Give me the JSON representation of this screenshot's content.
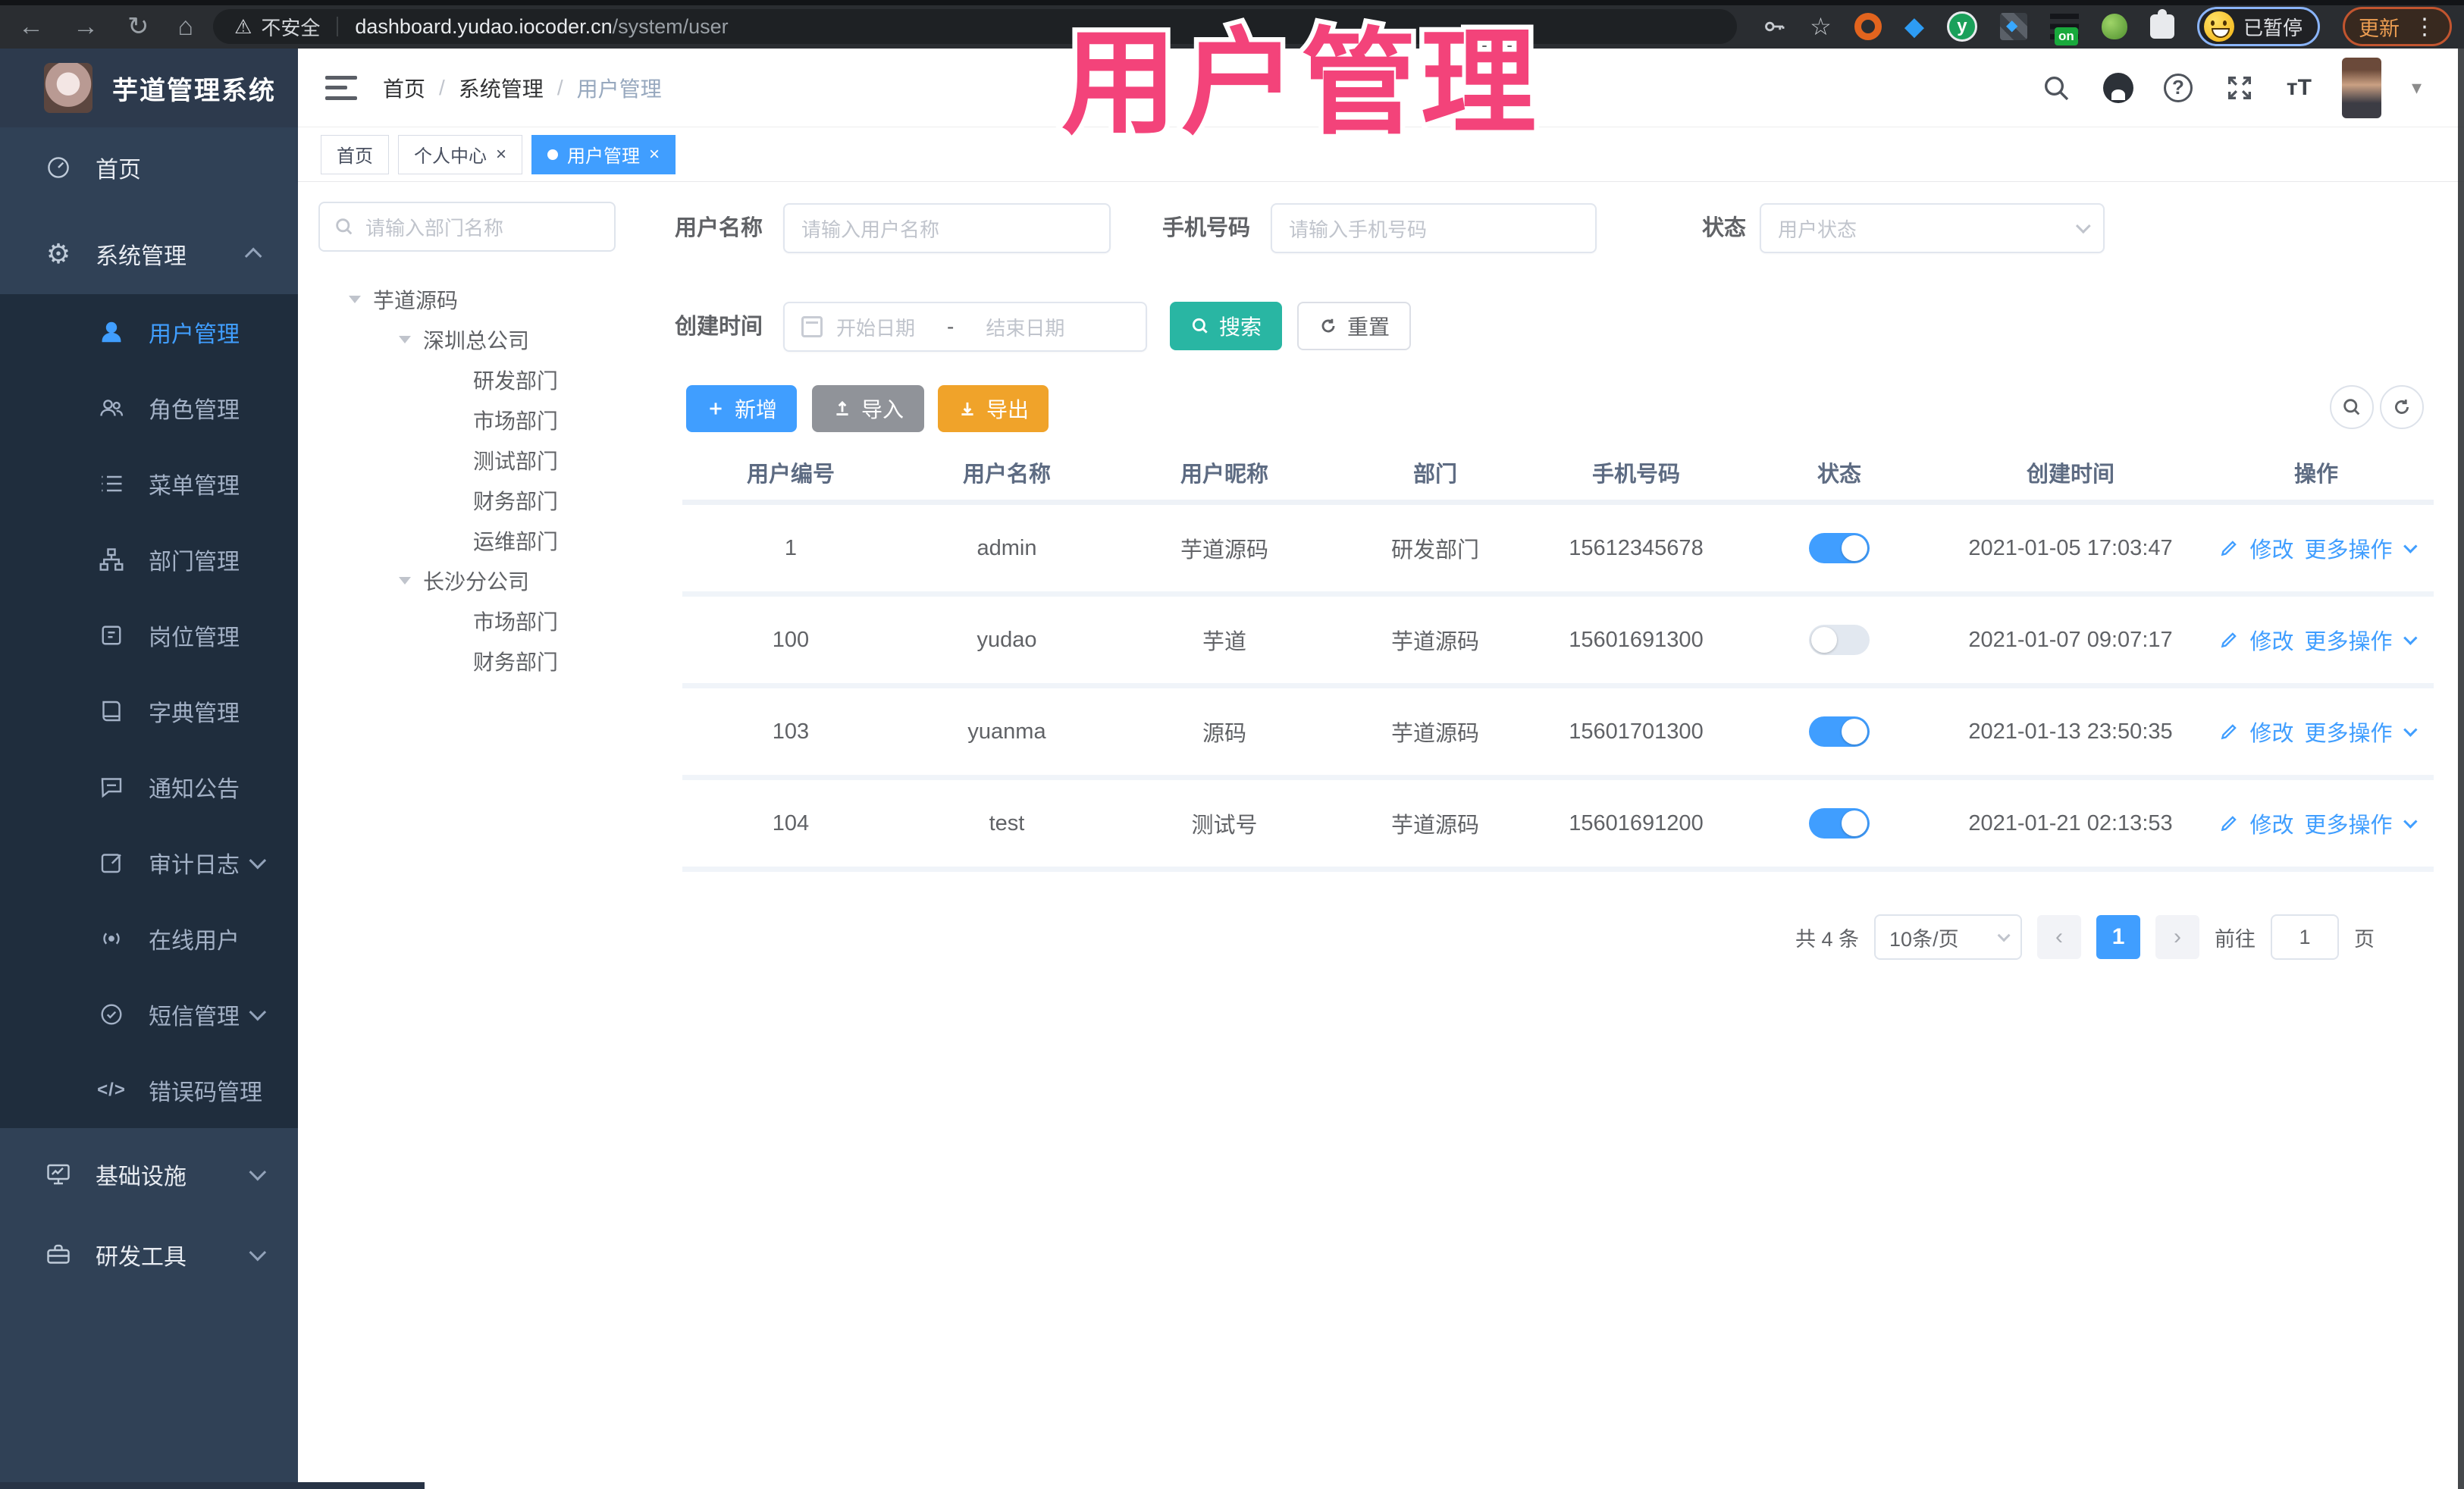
{
  "browser": {
    "security_label": "不安全",
    "url_domain": "dashboard.yudao.iocoder.cn",
    "url_path": "/system/user",
    "ext_badge": "on",
    "profile_status": "已暂停",
    "update_label": "更新"
  },
  "sidebar": {
    "app_title": "芋道管理系统",
    "top_items": [
      {
        "label": "首页"
      },
      {
        "label": "系统管理"
      }
    ],
    "sub_items": [
      {
        "label": "用户管理"
      },
      {
        "label": "角色管理"
      },
      {
        "label": "菜单管理"
      },
      {
        "label": "部门管理"
      },
      {
        "label": "岗位管理"
      },
      {
        "label": "字典管理"
      },
      {
        "label": "通知公告"
      },
      {
        "label": "审计日志"
      },
      {
        "label": "在线用户"
      },
      {
        "label": "短信管理"
      },
      {
        "label": "错误码管理"
      }
    ],
    "bottom_items": [
      {
        "label": "基础设施"
      },
      {
        "label": "研发工具"
      }
    ]
  },
  "header": {
    "breadcrumb": [
      "首页",
      "系统管理",
      "用户管理"
    ]
  },
  "tabs": [
    {
      "label": "首页"
    },
    {
      "label": "个人中心"
    },
    {
      "label": "用户管理"
    }
  ],
  "tree": {
    "search_placeholder": "请输入部门名称",
    "nodes": [
      {
        "label": "芋道源码"
      },
      {
        "label": "深圳总公司"
      },
      {
        "label": "研发部门"
      },
      {
        "label": "市场部门"
      },
      {
        "label": "测试部门"
      },
      {
        "label": "财务部门"
      },
      {
        "label": "运维部门"
      },
      {
        "label": "长沙分公司"
      },
      {
        "label": "市场部门"
      },
      {
        "label": "财务部门"
      }
    ]
  },
  "filters": {
    "username_label": "用户名称",
    "username_placeholder": "请输入用户名称",
    "mobile_label": "手机号码",
    "mobile_placeholder": "请输入手机号码",
    "status_label": "状态",
    "status_placeholder": "用户状态",
    "created_label": "创建时间",
    "date_start_placeholder": "开始日期",
    "date_separator": "-",
    "date_end_placeholder": "结束日期",
    "search_label": "搜索",
    "reset_label": "重置"
  },
  "toolbar": {
    "add_label": "新增",
    "import_label": "导入",
    "export_label": "导出"
  },
  "table": {
    "columns": [
      "用户编号",
      "用户名称",
      "用户昵称",
      "部门",
      "手机号码",
      "状态",
      "创建时间",
      "操作"
    ],
    "edit_label": "修改",
    "more_label": "更多操作",
    "rows": [
      {
        "id": "1",
        "username": "admin",
        "nickname": "芋道源码",
        "dept": "研发部门",
        "mobile": "15612345678",
        "status": "on",
        "created": "2021-01-05 17:03:47"
      },
      {
        "id": "100",
        "username": "yudao",
        "nickname": "芋道",
        "dept": "芋道源码",
        "mobile": "15601691300",
        "status": "off",
        "created": "2021-01-07 09:07:17"
      },
      {
        "id": "103",
        "username": "yuanma",
        "nickname": "源码",
        "dept": "芋道源码",
        "mobile": "15601701300",
        "status": "on",
        "created": "2021-01-13 23:50:35"
      },
      {
        "id": "104",
        "username": "test",
        "nickname": "测试号",
        "dept": "芋道源码",
        "mobile": "15601691200",
        "status": "on",
        "created": "2021-01-21 02:13:53"
      }
    ]
  },
  "pagination": {
    "total": "共 4 条",
    "page_size": "10条/页",
    "prev": "‹",
    "page": "1",
    "next": "›",
    "goto_label": "前往",
    "goto_value": "1",
    "unit": "页"
  },
  "watermark": "用户管理",
  "colors": {
    "primary": "#409eff",
    "search_teal": "#29b6a3",
    "export_yellow": "#f0a32a",
    "import_grey": "#909399",
    "sidebar_bg": "#304156",
    "submenu_bg": "#1f2d3d",
    "watermark_pink": "#f3437a"
  }
}
